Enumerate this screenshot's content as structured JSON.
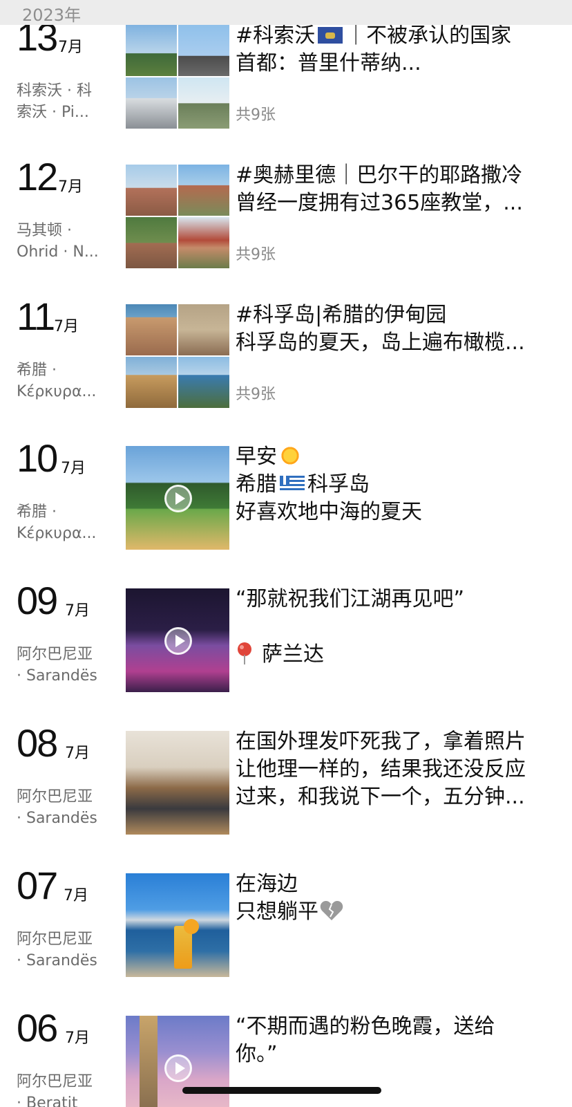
{
  "header": {
    "year_label": "2023年"
  },
  "entries": [
    {
      "day": "13",
      "month": "7月",
      "loc1": "科索沃 · 科",
      "loc2": "索沃 · Pi...",
      "line1": "#科索沃",
      "line1b": "｜不被承认的国家",
      "line2": "首都：普里什蒂纳...",
      "count": "共9张"
    },
    {
      "day": "12",
      "month": "7月",
      "loc1": "马其顿 ·",
      "loc2": "Ohrid · N...",
      "line1": "#奥赫里德｜巴尔干的耶路撒冷",
      "line2": "曾经一度拥有过365座教堂，...",
      "count": "共9张"
    },
    {
      "day": "11",
      "month": "7月",
      "loc1": "希腊 ·",
      "loc2": "Κέρκυρα...",
      "line1": "#科孚岛|希腊的伊甸园",
      "line2": "科孚岛的夏天，岛上遍布橄榄...",
      "count": "共9张"
    },
    {
      "day": "10",
      "month": "7月",
      "loc1": "希腊 ·",
      "loc2": "Κέρκυρα...",
      "line1": "早安",
      "line2a": "希腊",
      "line2b": "科孚岛",
      "line3": "好喜欢地中海的夏天"
    },
    {
      "day": "09",
      "month": "7月",
      "loc1": "阿尔巴尼亚",
      "loc2": "· Sarandës",
      "line1": "“那就祝我们江湖再见吧”",
      "line3": "萨兰达"
    },
    {
      "day": "08",
      "month": "7月",
      "loc1": "阿尔巴尼亚",
      "loc2": "· Sarandës",
      "line1": "在国外理发吓死我了，拿着照片",
      "line2": "让他理一样的，结果我还没反应",
      "line3": "过来，和我说下一个，五分钟..."
    },
    {
      "day": "07",
      "month": "7月",
      "loc1": "阿尔巴尼亚",
      "loc2": "· Sarandës",
      "line1": "在海边",
      "line2": "只想躺平"
    },
    {
      "day": "06",
      "month": "7月",
      "loc1": "阿尔巴尼亚",
      "loc2": "· Beratit",
      "line1": "“不期而遇的粉色晚霞，送给",
      "line2": "你。”"
    }
  ],
  "icons": {
    "play": "play-icon",
    "kosovo_flag": "kosovo-flag-icon",
    "greece_flag": "greece-flag-icon",
    "sun": "sun-emoji-icon",
    "heart": "broken-heart-icon",
    "pin": "location-pin-icon"
  }
}
